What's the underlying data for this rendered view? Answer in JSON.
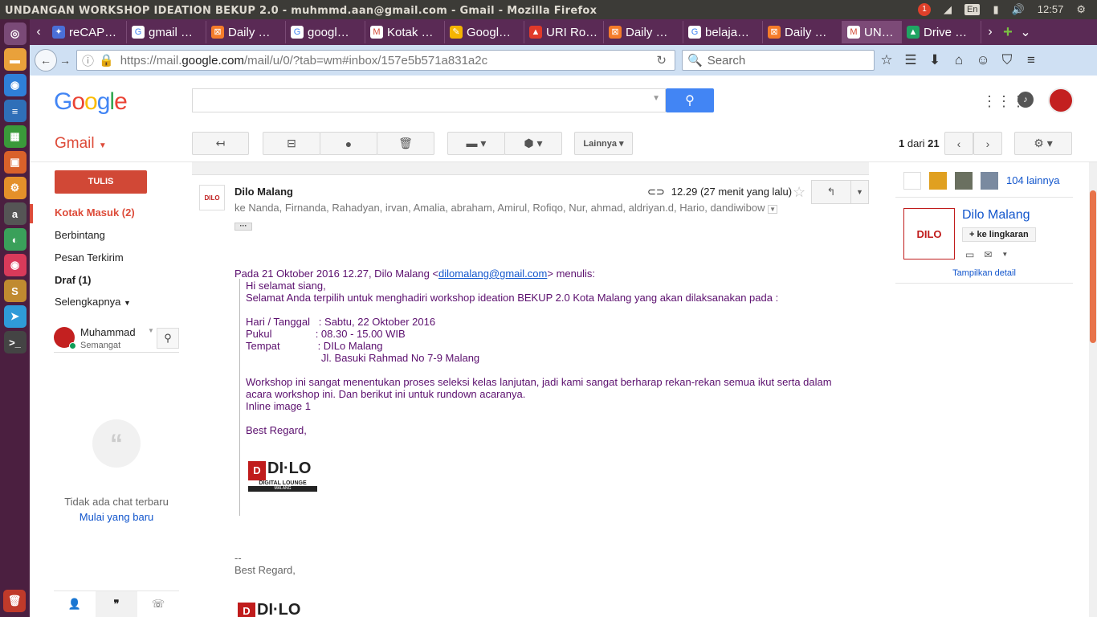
{
  "window": {
    "title": "UNDANGAN WORKSHOP IDEATION BEKUP 2.0 - muhmmd.aan@gmail.com - Gmail - Mozilla Firefox"
  },
  "system": {
    "notif_count": "1",
    "keyboard": "En",
    "clock": "12:57"
  },
  "launcher": {
    "items": [
      "ubuntu-dash",
      "files",
      "firefox",
      "writer",
      "calc",
      "impress",
      "settings",
      "amazon",
      "software",
      "screenshot",
      "sublime",
      "telegram",
      "terminal",
      "trash"
    ]
  },
  "tabs": [
    {
      "label": "reCAP…",
      "icon": "puzzle"
    },
    {
      "label": "gmail …",
      "icon": "google"
    },
    {
      "label": "Daily …",
      "icon": "xampp"
    },
    {
      "label": "googl…",
      "icon": "google"
    },
    {
      "label": "Kotak …",
      "icon": "gmail"
    },
    {
      "label": "Googl…",
      "icon": "keep"
    },
    {
      "label": "URI Ro…",
      "icon": "fire"
    },
    {
      "label": "Daily …",
      "icon": "xampp"
    },
    {
      "label": "belaja…",
      "icon": "google"
    },
    {
      "label": "Daily …",
      "icon": "xampp"
    },
    {
      "label": "UN…",
      "icon": "gmail"
    },
    {
      "label": "Drive …",
      "icon": "drive"
    }
  ],
  "nav": {
    "url_prefix": "https://mail.",
    "url_host": "google.com",
    "url_rest": "/mail/u/0/?tab=wm#inbox/157e5b571a831a2c",
    "search_placeholder": "Search"
  },
  "gmail": {
    "brand": "Gmail",
    "more_label": "Lainnya",
    "pager_current": "1",
    "pager_of": "dari",
    "pager_total": "21",
    "compose_label": "TULIS",
    "folders": [
      "Kotak Masuk (2)",
      "Berbintang",
      "Pesan Terkirim",
      "Draf (1)",
      "Selengkapnya"
    ],
    "hangout_user": "Muhammad",
    "hangout_status": "Semangat",
    "no_chat": "Tidak ada chat terbaru",
    "start_new": "Mulai yang baru"
  },
  "message": {
    "sender": "Dilo Malang",
    "time": "12.29 (27 menit yang lalu)",
    "recipients": "ke Nanda, Firnanda, Rahadyan, irvan, Amalia, abraham, Amirul, Rofiqo, Nur, ahmad, aldriyan.d, Hario, dandiwibow",
    "quote_header_pre": "Pada 21 Oktober 2016 12.27, Dilo Malang <",
    "quote_email": "dilomalang@gmail.com",
    "quote_header_post": "> menulis:",
    "lines": [
      "Hi selamat siang,",
      "Selamat Anda terpilih untuk menghadiri workshop ideation BEKUP 2.0 Kota Malang yang akan dilaksanakan pada :",
      "Hari / Tanggal   : Sabtu, 22 Oktober 2016",
      "Pukul               : 08.30 - 15.00 WIB",
      "Tempat             : DILo Malang",
      "                          Jl. Basuki Rahmad No 7-9 Malang",
      "Workshop ini sangat menentukan proses seleksi kelas lanjutan, jadi kami sangat berharap rekan-rekan semua ikut serta dalam",
      "acara workshop ini. Dan berikut ini untuk rundown acaranya.",
      "Inline image 1",
      "Best Regard,"
    ],
    "sig_dash": "--",
    "sig_regard": "Best Regard,",
    "logo_text": "DI·LO",
    "logo_sub": "DIGITAL LOUNGE",
    "logo_city": "MALANG"
  },
  "contact": {
    "more_people": "104 lainnya",
    "name": "Dilo Malang",
    "add_circle": "+ ke lingkaran",
    "show_detail": "Tampilkan detail"
  }
}
